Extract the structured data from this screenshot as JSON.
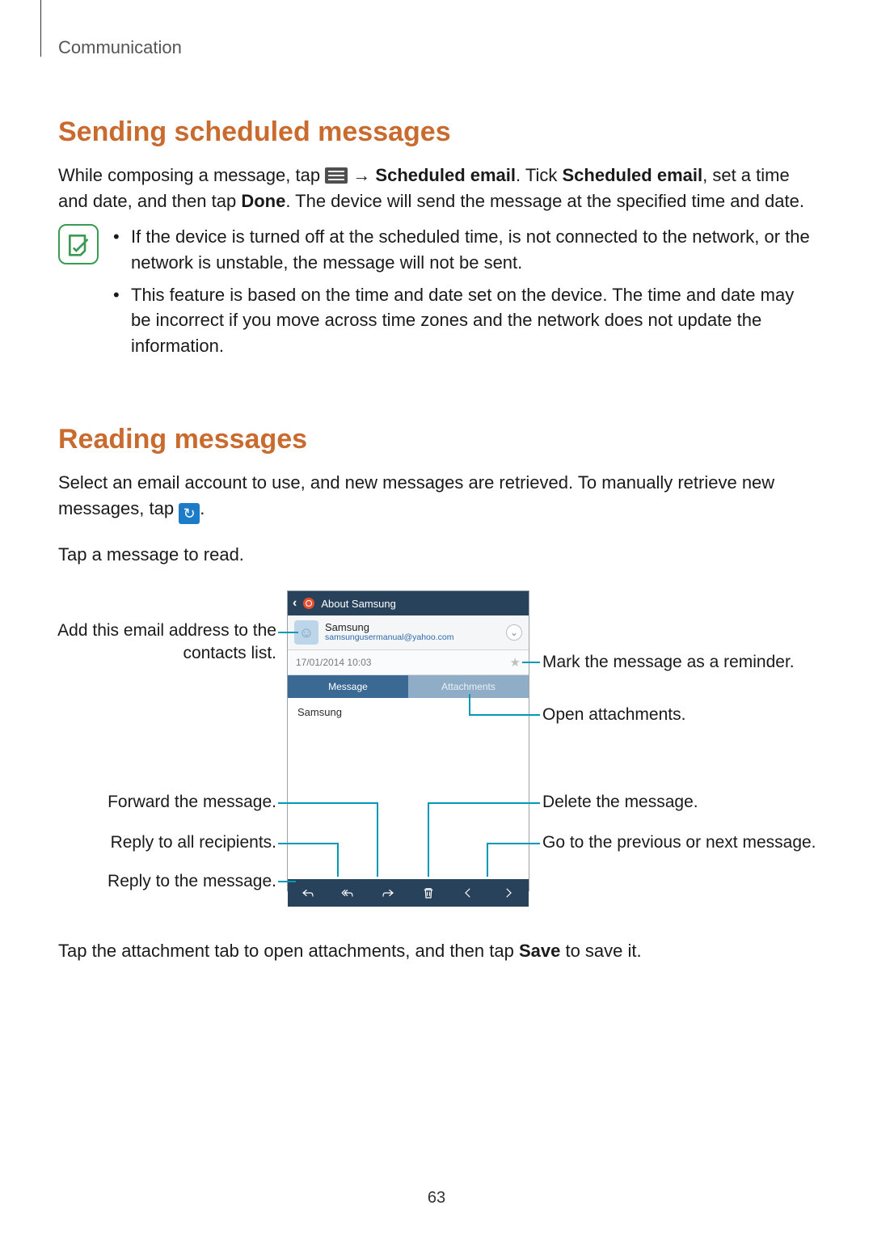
{
  "chapter": "Communication",
  "section1_heading": "Sending scheduled messages",
  "section1_p_before": "While composing a message, tap ",
  "section1_p_arrow": " → ",
  "section1_p_bold1": "Scheduled email",
  "section1_p_mid1": ". Tick ",
  "section1_p_bold2": "Scheduled email",
  "section1_p_mid2": ", set a time and date, and then tap ",
  "section1_p_bold3": "Done",
  "section1_p_after": ". The device will send the message at the specified time and date.",
  "note_items": [
    "If the device is turned off at the scheduled time, is not connected to the network, or the network is unstable, the message will not be sent.",
    "This feature is based on the time and date set on the device. The time and date may be incorrect if you move across time zones and the network does not update the information."
  ],
  "section2_heading": "Reading messages",
  "section2_p1_before": "Select an email account to use, and new messages are retrieved. To manually retrieve new messages, tap ",
  "section2_p1_after": ".",
  "section2_p2": "Tap a message to read.",
  "phone": {
    "title": "About Samsung",
    "sender_name": "Samsung",
    "sender_email": "samsungusermanual@yahoo.com",
    "timestamp": "17/01/2014 10:03",
    "tab_message": "Message",
    "tab_attachments": "Attachments",
    "body_text": "Samsung"
  },
  "callouts": {
    "add_contact": "Add this email address to the contacts list.",
    "mark_reminder": "Mark the message as a reminder.",
    "open_attachments": "Open attachments.",
    "forward": "Forward the message.",
    "reply_all": "Reply to all recipients.",
    "reply": "Reply to the message.",
    "delete": "Delete the message.",
    "prev_next": "Go to the previous or next message."
  },
  "section2_p3_before": "Tap the attachment tab to open attachments, and then tap ",
  "section2_p3_bold": "Save",
  "section2_p3_after": " to save it.",
  "page_number": "63"
}
